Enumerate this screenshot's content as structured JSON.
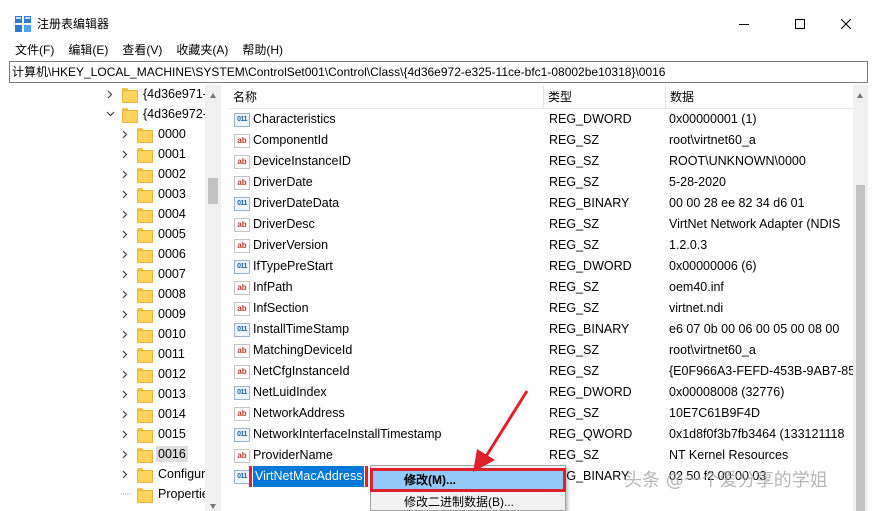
{
  "window": {
    "title": "注册表编辑器",
    "controls": {
      "minimize_icon": "minimize-icon",
      "maximize_icon": "maximize-icon",
      "close_icon": "close-icon"
    }
  },
  "menubar": [
    "文件(F)",
    "编辑(E)",
    "查看(V)",
    "收藏夹(A)",
    "帮助(H)"
  ],
  "address": "计算机\\HKEY_LOCAL_MACHINE\\SYSTEM\\ControlSet001\\Control\\Class\\{4d36e972-e325-11ce-bfc1-08002be10318}\\0016",
  "tree": {
    "items": [
      {
        "label": "{4d36e971-",
        "state": "collapsed",
        "level": 0
      },
      {
        "label": "{4d36e972-",
        "state": "expanded",
        "level": 0
      },
      {
        "label": "0000",
        "state": "collapsed",
        "level": 1
      },
      {
        "label": "0001",
        "state": "collapsed",
        "level": 1
      },
      {
        "label": "0002",
        "state": "collapsed",
        "level": 1
      },
      {
        "label": "0003",
        "state": "collapsed",
        "level": 1
      },
      {
        "label": "0004",
        "state": "collapsed",
        "level": 1
      },
      {
        "label": "0005",
        "state": "collapsed",
        "level": 1
      },
      {
        "label": "0006",
        "state": "collapsed",
        "level": 1
      },
      {
        "label": "0007",
        "state": "collapsed",
        "level": 1
      },
      {
        "label": "0008",
        "state": "collapsed",
        "level": 1
      },
      {
        "label": "0009",
        "state": "collapsed",
        "level": 1
      },
      {
        "label": "0010",
        "state": "collapsed",
        "level": 1
      },
      {
        "label": "0011",
        "state": "collapsed",
        "level": 1
      },
      {
        "label": "0012",
        "state": "collapsed",
        "level": 1
      },
      {
        "label": "0013",
        "state": "collapsed",
        "level": 1
      },
      {
        "label": "0014",
        "state": "collapsed",
        "level": 1
      },
      {
        "label": "0015",
        "state": "collapsed",
        "level": 1
      },
      {
        "label": "0016",
        "state": "selected",
        "level": 1
      },
      {
        "label": "Configur",
        "state": "collapsed",
        "level": 1
      },
      {
        "label": "Propertie",
        "state": "leaf",
        "level": 1
      }
    ]
  },
  "list": {
    "headers": {
      "name": "名称",
      "type": "类型",
      "data": "数据"
    },
    "rows": [
      {
        "name": "Characteristics",
        "type": "REG_DWORD",
        "data": "0x00000001 (1)",
        "kind": "bin"
      },
      {
        "name": "ComponentId",
        "type": "REG_SZ",
        "data": "root\\virtnet60_a",
        "kind": "sz"
      },
      {
        "name": "DeviceInstanceID",
        "type": "REG_SZ",
        "data": "ROOT\\UNKNOWN\\0000",
        "kind": "sz"
      },
      {
        "name": "DriverDate",
        "type": "REG_SZ",
        "data": "5-28-2020",
        "kind": "sz"
      },
      {
        "name": "DriverDateData",
        "type": "REG_BINARY",
        "data": "00 00 28 ee 82 34 d6 01",
        "kind": "bin"
      },
      {
        "name": "DriverDesc",
        "type": "REG_SZ",
        "data": "VirtNet Network Adapter (NDIS",
        "kind": "sz"
      },
      {
        "name": "DriverVersion",
        "type": "REG_SZ",
        "data": "1.2.0.3",
        "kind": "sz"
      },
      {
        "name": "IfTypePreStart",
        "type": "REG_DWORD",
        "data": "0x00000006 (6)",
        "kind": "bin"
      },
      {
        "name": "InfPath",
        "type": "REG_SZ",
        "data": "oem40.inf",
        "kind": "sz"
      },
      {
        "name": "InfSection",
        "type": "REG_SZ",
        "data": "virtnet.ndi",
        "kind": "sz"
      },
      {
        "name": "InstallTimeStamp",
        "type": "REG_BINARY",
        "data": "e6 07 0b 00 06 00 05 00 08 00",
        "kind": "bin"
      },
      {
        "name": "MatchingDeviceId",
        "type": "REG_SZ",
        "data": "root\\virtnet60_a",
        "kind": "sz"
      },
      {
        "name": "NetCfgInstanceId",
        "type": "REG_SZ",
        "data": "{E0F966A3-FEFD-453B-9AB7-85",
        "kind": "sz"
      },
      {
        "name": "NetLuidIndex",
        "type": "REG_DWORD",
        "data": "0x00008008 (32776)",
        "kind": "bin"
      },
      {
        "name": "NetworkAddress",
        "type": "REG_SZ",
        "data": "10E7C61B9F4D",
        "kind": "sz"
      },
      {
        "name": "NetworkInterfaceInstallTimestamp",
        "type": "REG_QWORD",
        "data": "0x1d8f0f3b7fb3464 (133121118",
        "kind": "bin"
      },
      {
        "name": "ProviderName",
        "type": "REG_SZ",
        "data": "NT Kernel Resources",
        "kind": "sz"
      },
      {
        "name": "VirtNetMacAddress",
        "type": "REG_BINARY",
        "data": "02 50 f2 00 00 03",
        "kind": "bin",
        "selected": true
      }
    ]
  },
  "context_menu": {
    "items": [
      {
        "label": "修改(M)...",
        "highlighted": true
      },
      {
        "label": "修改二进制数据(B)...",
        "highlighted": false
      }
    ]
  },
  "watermark": "头条 @一个爱分享的学姐",
  "colors": {
    "selection": "#0078d7",
    "highlight_box": "#e0202a",
    "menu_hover": "#91c9f7",
    "folder": "#ffd35c"
  }
}
